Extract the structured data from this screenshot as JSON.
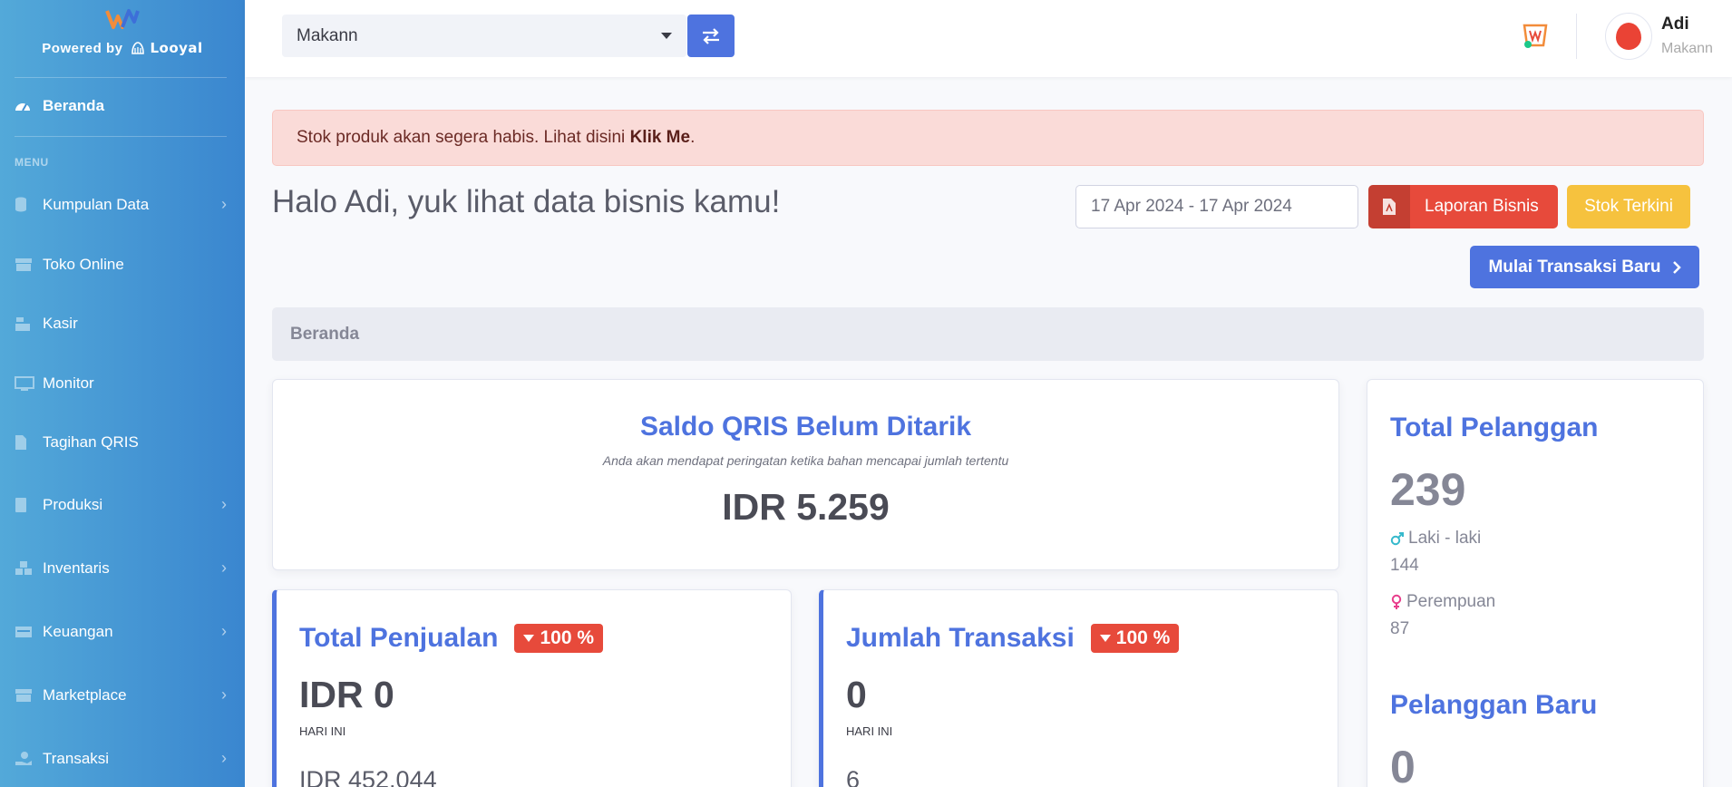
{
  "sidebar": {
    "powered_by": "Powered by",
    "powered_brand": "Looyal",
    "home": "Beranda",
    "menu_heading": "MENU",
    "items": [
      {
        "label": "Kumpulan Data",
        "icon": "database-icon",
        "has_children": true
      },
      {
        "label": "Toko Online",
        "icon": "store-icon",
        "has_children": false
      },
      {
        "label": "Kasir",
        "icon": "cash-register-icon",
        "has_children": false
      },
      {
        "label": "Monitor",
        "icon": "monitor-icon",
        "has_children": false
      },
      {
        "label": "Tagihan QRIS",
        "icon": "file-icon",
        "has_children": false
      },
      {
        "label": "Produksi",
        "icon": "book-icon",
        "has_children": true
      },
      {
        "label": "Inventaris",
        "icon": "boxes-icon",
        "has_children": true
      },
      {
        "label": "Keuangan",
        "icon": "money-icon",
        "has_children": true
      },
      {
        "label": "Marketplace",
        "icon": "store-icon",
        "has_children": true
      },
      {
        "label": "Transaksi",
        "icon": "hand-holding-icon",
        "has_children": true
      }
    ]
  },
  "topbar": {
    "store_select_value": "Makann",
    "user_name": "Adi",
    "user_store": "Makann"
  },
  "alert": {
    "text": "Stok produk akan segera habis. Lihat disini ",
    "link": "Klik Me",
    "suffix": "."
  },
  "header": {
    "greeting": "Halo Adi, yuk lihat data bisnis kamu!",
    "date_range": "17 Apr 2024 - 17 Apr 2024",
    "laporan_label": "Laporan Bisnis",
    "stok_label": "Stok Terkini",
    "mulai_label": "Mulai Transaksi Baru"
  },
  "breadcrumb": "Beranda",
  "qris": {
    "title": "Saldo QRIS Belum Ditarik",
    "subtitle": "Anda akan mendapat peringatan ketika bahan mencapai jumlah tertentu",
    "value": "IDR 5.259"
  },
  "penjualan": {
    "title": "Total Penjualan",
    "badge": "100 %",
    "value": "IDR 0",
    "label": "HARI INI",
    "previous": "IDR 452.044"
  },
  "transaksi": {
    "title": "Jumlah Transaksi",
    "badge": "100 %",
    "value": "0",
    "label": "HARI INI",
    "previous": "6"
  },
  "pelanggan": {
    "title": "Total Pelanggan",
    "total": "239",
    "male_label": "Laki - laki",
    "male_value": "144",
    "female_label": "Perempuan",
    "female_value": "87",
    "new_title": "Pelanggan Baru",
    "new_value": "0"
  },
  "colors": {
    "primary": "#4e73df",
    "danger": "#e74a3b",
    "warning": "#f6c23e",
    "sidebar_start": "#53a9d9",
    "sidebar_end": "#3a86cf"
  }
}
